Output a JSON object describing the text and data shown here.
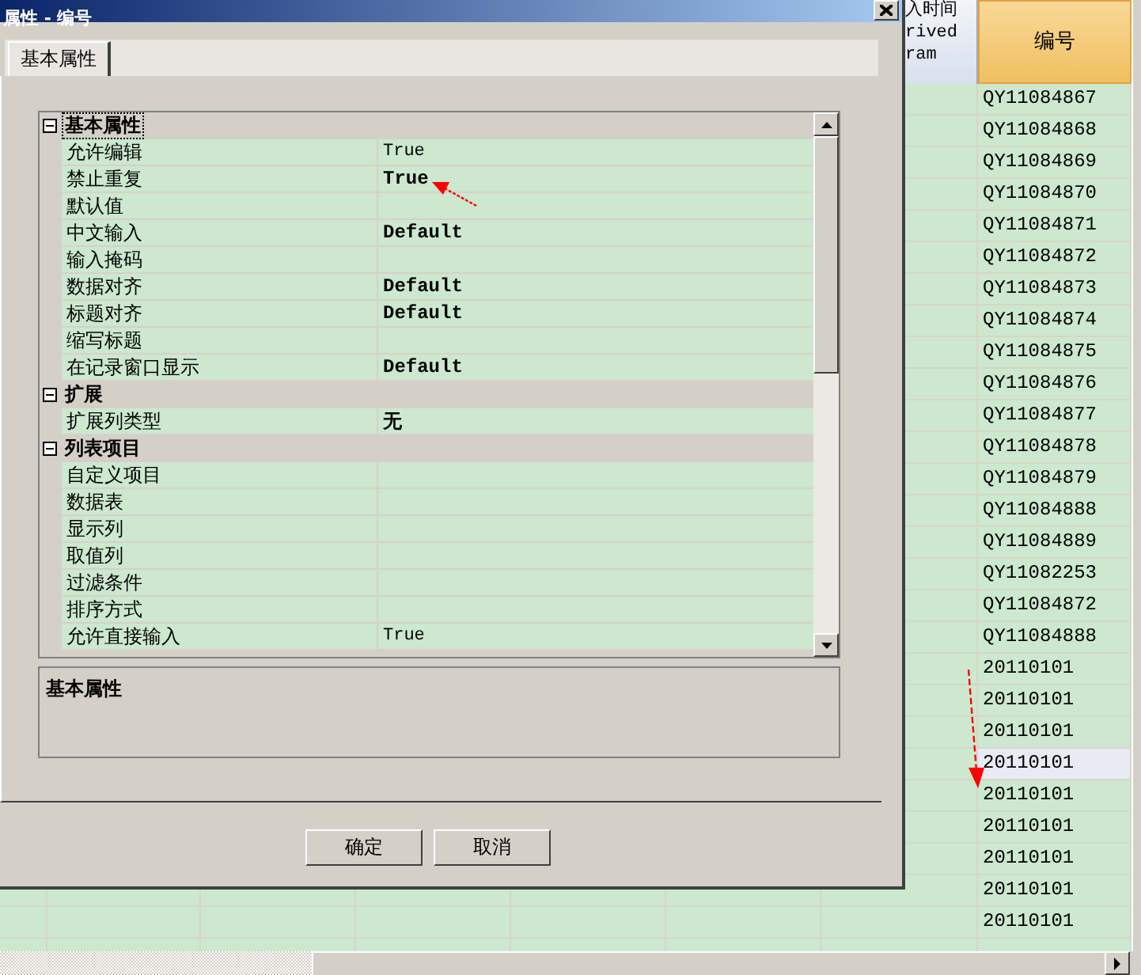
{
  "sheet": {
    "columns": [
      {
        "lines": [
          "入时间",
          "rived",
          "ram"
        ],
        "selected": false
      },
      {
        "lines": [
          "编号"
        ],
        "selected": true
      }
    ],
    "rows": [
      {
        "id": "QY11084867",
        "selected": false
      },
      {
        "id": "QY11084868",
        "selected": false
      },
      {
        "id": "QY11084869",
        "selected": false
      },
      {
        "id": "QY11084870",
        "selected": false
      },
      {
        "id": "QY11084871",
        "selected": false
      },
      {
        "id": "QY11084872",
        "selected": false
      },
      {
        "id": "QY11084873",
        "selected": false
      },
      {
        "id": "QY11084874",
        "selected": false
      },
      {
        "id": "QY11084875",
        "selected": false
      },
      {
        "id": "QY11084876",
        "selected": false
      },
      {
        "id": "QY11084877",
        "selected": false
      },
      {
        "id": "QY11084878",
        "selected": false
      },
      {
        "id": "QY11084879",
        "selected": false
      },
      {
        "id": "QY11084888",
        "selected": false
      },
      {
        "id": "QY11084889",
        "selected": false
      },
      {
        "id": "QY11082253",
        "selected": false
      },
      {
        "id": "QY11084872",
        "selected": false
      },
      {
        "id": "QY11084888",
        "selected": false
      },
      {
        "id": "20110101",
        "selected": false
      },
      {
        "id": "20110101",
        "selected": false
      },
      {
        "id": "20110101",
        "selected": false
      },
      {
        "id": "20110101",
        "selected": true
      },
      {
        "id": "20110101",
        "selected": false
      },
      {
        "id": "20110101",
        "selected": false
      },
      {
        "id": "20110101",
        "selected": false
      },
      {
        "id": "20110101",
        "selected": false
      },
      {
        "id": "20110101",
        "selected": false
      }
    ]
  },
  "dialog": {
    "title": "属性 - 编号",
    "tabs": [
      {
        "label": "基本属性",
        "selected": true
      }
    ],
    "property_grid": {
      "categories": [
        {
          "name": "基本属性",
          "expanded": true,
          "items": [
            {
              "name": "允许编辑",
              "value": "True",
              "bold": false
            },
            {
              "name": "禁止重复",
              "value": "True",
              "bold": true
            },
            {
              "name": "默认值"
            },
            {
              "name": "中文输入",
              "value": "Default",
              "bold": true
            },
            {
              "name": "输入掩码"
            },
            {
              "name": "数据对齐",
              "value": "Default",
              "bold": true
            },
            {
              "name": "标题对齐",
              "value": "Default",
              "bold": true
            },
            {
              "name": "缩写标题"
            },
            {
              "name": "在记录窗口显示",
              "value": "Default",
              "bold": true
            }
          ]
        },
        {
          "name": "扩展",
          "expanded": true,
          "items": [
            {
              "name": "扩展列类型",
              "value": "无",
              "bold": true
            }
          ]
        },
        {
          "name": "列表项目",
          "expanded": true,
          "items": [
            {
              "name": "自定义项目"
            },
            {
              "name": "数据表"
            },
            {
              "name": "显示列"
            },
            {
              "name": "取值列"
            },
            {
              "name": "过滤条件"
            },
            {
              "name": "排序方式"
            },
            {
              "name": "允许直接输入",
              "value": "True",
              "bold": false
            }
          ]
        }
      ]
    },
    "description": {
      "title": "基本属性"
    },
    "buttons": [
      "确定",
      "取消"
    ]
  }
}
